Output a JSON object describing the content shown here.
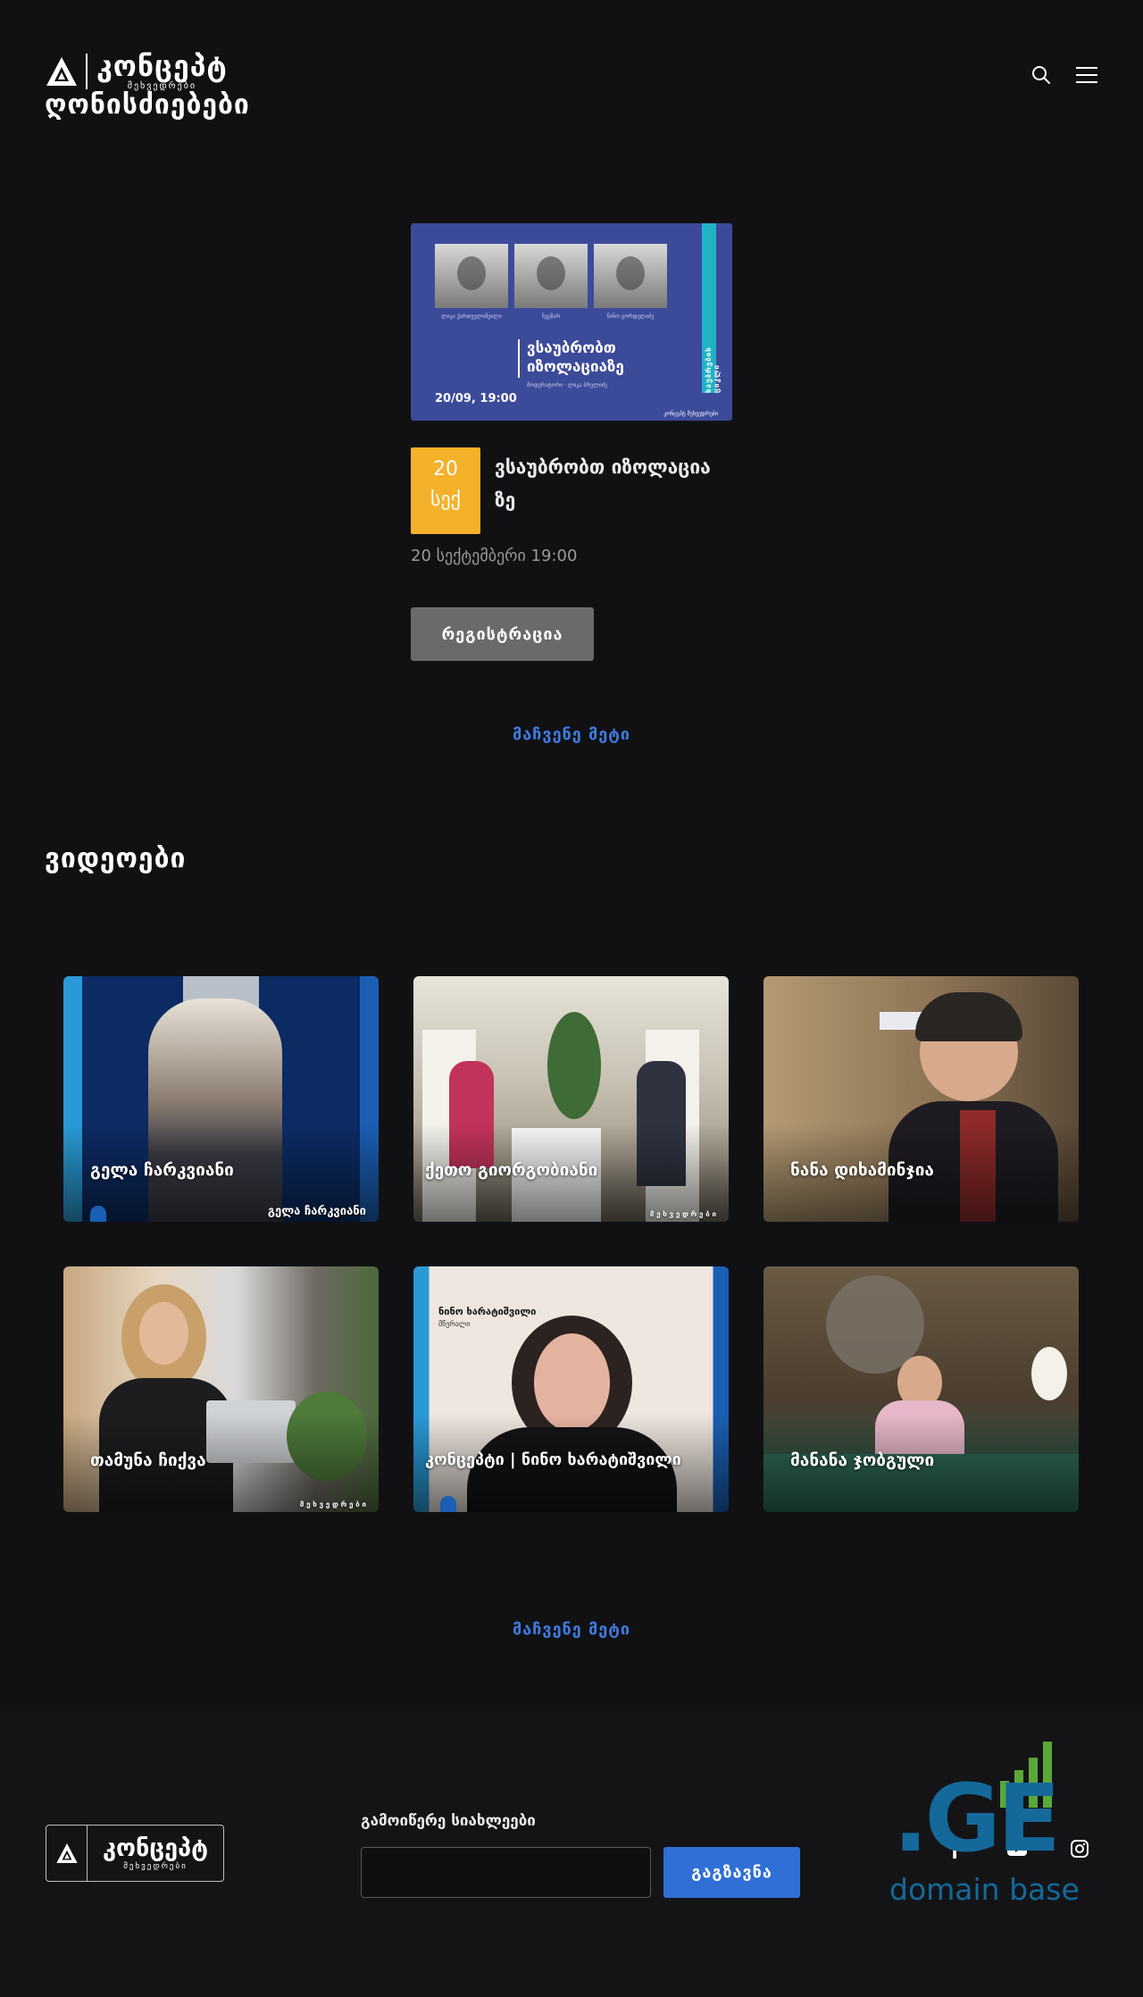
{
  "header": {
    "logo_name": "კონცეპტ",
    "logo_sub": "მეხვედრები",
    "page_title": "ღონისძიებები",
    "search_icon": "search-icon",
    "menu_icon": "hamburger-menu-icon"
  },
  "event": {
    "poster": {
      "captions": [
        "ლიკა ქართველიშვილი",
        "ნუგზარ",
        "ნინო გორდელაძე"
      ],
      "headline_line1": "ვსაუბრობთ",
      "headline_line2": "იზოლაციაზე",
      "sub": "მოდერატორი · ლიკა ბრელიძე",
      "date": "20/09, 19:00",
      "ribbon": "საუბრების ციკლი",
      "org": "კონცეპტ მეხვედრები"
    },
    "day": "20",
    "month": "სექ",
    "title": "ვსაუბრობთ იზოლაცია ზე",
    "time": "20 სექტემბერი 19:00",
    "register_label": "რეგისტრაცია"
  },
  "show_more_events": "მაჩვენე მეტი",
  "videos_section_title": "ვიდეოები",
  "videos": [
    {
      "title": "გელა ჩარკვიანი",
      "tag": "გელა ჩარკვიანი"
    },
    {
      "title": "ქეთო გიორგობიანი",
      "tag": "მ ე ხ ვ ე დ რ ე ბ ი"
    },
    {
      "title": "ნანა დიხამინჯია",
      "tag": ""
    },
    {
      "title": "თამუნა ჩიქვა",
      "tag": "მ ე ხ ვ ე დ რ ე ბ ი"
    },
    {
      "title": "კონცეპტი | ნინო ხარატიშვილი",
      "tag": "",
      "top_caption": "ნინო ხარატიშვილი",
      "top_caption2": "მწერალი"
    },
    {
      "title": "მანანა ჯობგული",
      "tag": ""
    }
  ],
  "show_more_videos": "მაჩვენე მეტი",
  "footer": {
    "logo_name": "კონცეპტ",
    "logo_sub": "მეხვედრები",
    "newsletter_label": "გამოიწერე სიახლეები",
    "newsletter_placeholder": "",
    "send_label": "გაგზავნა",
    "social": [
      "facebook-icon",
      "youtube-icon",
      "instagram-icon"
    ]
  },
  "watermark": {
    "text": ".GE",
    "caption": "domain base"
  },
  "colors": {
    "background": "#111114",
    "date_badge": "#f4b12a",
    "accent_link": "#3f7be0",
    "send_button": "#2f6fd6",
    "register_button": "#6a6a6a"
  }
}
